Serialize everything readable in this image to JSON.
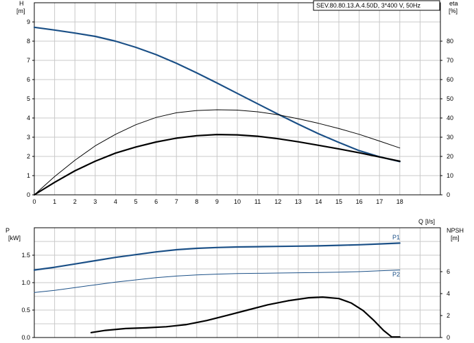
{
  "chart_data": [
    {
      "type": "line",
      "title": "SEV.80.80.13.A.4.50D, 3*400 V, 50Hz",
      "xlabel": "Q [l/s]",
      "x_unit_label": "[l/s]",
      "x_axis_name": "Q",
      "ylabel": "H [m]",
      "y_axis_name": "H",
      "y_unit": "[m]",
      "y2label": "eta [%]",
      "y2_axis_name": "eta",
      "y2_unit": "[%]",
      "xlim": [
        0,
        20
      ],
      "ylim": [
        0,
        10
      ],
      "y2lim": [
        0,
        100
      ],
      "xticks": [
        "0",
        "1",
        "2",
        "3",
        "4",
        "5",
        "6",
        "7",
        "8",
        "9",
        "10",
        "11",
        "12",
        "13",
        "14",
        "15",
        "16",
        "17",
        "18"
      ],
      "yticks": [
        "0",
        "1",
        "2",
        "3",
        "4",
        "5",
        "6",
        "7",
        "8",
        "9"
      ],
      "y2ticks": [
        "0",
        "10",
        "20",
        "30",
        "40",
        "50",
        "60",
        "70",
        "80"
      ],
      "grid": true,
      "series": [
        {
          "axis": "left",
          "color": "#1a4f86",
          "width": 2.2,
          "x": [
            0,
            1,
            2,
            3,
            4,
            5,
            6,
            7,
            8,
            9,
            10,
            11,
            12,
            13,
            14,
            15,
            16,
            17,
            18
          ],
          "y": [
            8.72,
            8.58,
            8.42,
            8.25,
            8.0,
            7.68,
            7.3,
            6.85,
            6.35,
            5.82,
            5.28,
            4.74,
            4.2,
            3.68,
            3.18,
            2.73,
            2.3,
            1.98,
            1.73
          ]
        },
        {
          "axis": "right",
          "color": "#000000",
          "width": 1,
          "x": [
            0,
            1,
            2,
            3,
            4,
            5,
            6,
            7,
            8,
            9,
            10,
            11,
            12,
            13,
            14,
            15,
            16,
            17,
            18
          ],
          "y": [
            0,
            9.5,
            18,
            25.5,
            31.5,
            36.5,
            40.3,
            42.7,
            43.9,
            44.3,
            44.1,
            43.2,
            41.7,
            39.6,
            37.2,
            34.5,
            31.5,
            28,
            24.4
          ]
        },
        {
          "axis": "right",
          "color": "#000000",
          "width": 2.2,
          "x": [
            0,
            1,
            2,
            3,
            4,
            5,
            6,
            7,
            8,
            9,
            10,
            11,
            12,
            13,
            14,
            15,
            16,
            17,
            18
          ],
          "y": [
            0,
            6.5,
            12.5,
            17.5,
            21.7,
            24.9,
            27.5,
            29.5,
            30.8,
            31.4,
            31.2,
            30.5,
            29.2,
            27.6,
            25.8,
            23.9,
            21.9,
            19.7,
            17.5
          ]
        }
      ]
    },
    {
      "type": "line",
      "xlabel": "",
      "ylabel": "P [kW]",
      "y_axis_name": "P",
      "y_unit": "[kW]",
      "y2label": "NPSH [m]",
      "y2_axis_name": "NPSH",
      "y2_unit": "[m]",
      "xlim": [
        0,
        20
      ],
      "ylim": [
        0,
        2
      ],
      "y2lim": [
        0,
        10
      ],
      "yticks": [
        "0.0",
        "0.5",
        "1.0",
        "1.5"
      ],
      "y2ticks": [
        "0",
        "2",
        "4",
        "6"
      ],
      "grid": true,
      "series": [
        {
          "name": "P1",
          "axis": "left",
          "color": "#1a4f86",
          "width": 2.2,
          "x": [
            0,
            1,
            2,
            3,
            4,
            5,
            6,
            7,
            8,
            9,
            10,
            11,
            12,
            13,
            14,
            15,
            16,
            17,
            18
          ],
          "y": [
            1.23,
            1.28,
            1.34,
            1.4,
            1.46,
            1.51,
            1.56,
            1.6,
            1.625,
            1.64,
            1.65,
            1.655,
            1.66,
            1.665,
            1.67,
            1.68,
            1.69,
            1.705,
            1.72
          ]
        },
        {
          "name": "P2",
          "axis": "left",
          "color": "#1a4f86",
          "width": 1,
          "x": [
            0,
            1,
            2,
            3,
            4,
            5,
            6,
            7,
            8,
            9,
            10,
            11,
            12,
            13,
            14,
            15,
            16,
            17,
            18
          ],
          "y": [
            0.82,
            0.86,
            0.91,
            0.96,
            1.01,
            1.05,
            1.09,
            1.12,
            1.14,
            1.155,
            1.165,
            1.17,
            1.175,
            1.18,
            1.185,
            1.19,
            1.2,
            1.215,
            1.23
          ]
        },
        {
          "axis": "right",
          "color": "#000000",
          "width": 2.2,
          "x": [
            2.8,
            3.5,
            4.5,
            5.5,
            6.5,
            7.5,
            8.5,
            9.5,
            10.5,
            11.5,
            12.5,
            13.5,
            14.2,
            15,
            15.6,
            16.2,
            16.7,
            17.2,
            17.6,
            18
          ],
          "y": [
            0.45,
            0.65,
            0.82,
            0.88,
            0.98,
            1.18,
            1.55,
            2.02,
            2.5,
            2.98,
            3.35,
            3.62,
            3.68,
            3.55,
            3.15,
            2.45,
            1.6,
            0.65,
            0.05,
            0.05
          ]
        }
      ]
    }
  ]
}
